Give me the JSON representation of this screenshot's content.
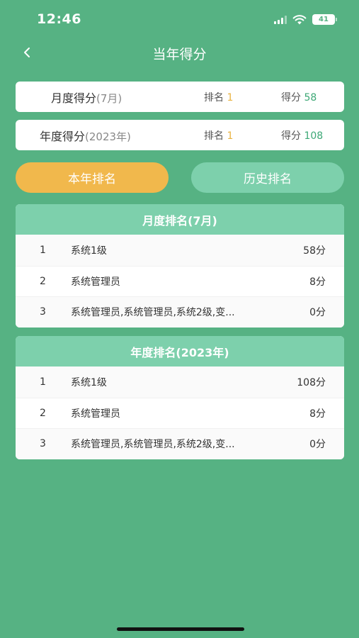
{
  "status": {
    "time": "12:46",
    "battery": "41"
  },
  "nav": {
    "title": "当年得分"
  },
  "score_cards": [
    {
      "label": "月度得分",
      "sub": "(7月)",
      "rank_label": "排名",
      "rank_value": "1",
      "score_label": "得分",
      "score_value": "58"
    },
    {
      "label": "年度得分",
      "sub": "(2023年)",
      "rank_label": "排名",
      "rank_value": "1",
      "score_label": "得分",
      "score_value": "108"
    }
  ],
  "tabs": {
    "current": "本年排名",
    "history": "历史排名"
  },
  "monthly": {
    "title": "月度排名(7月)",
    "rows": [
      {
        "rank": "1",
        "name": "系统1级",
        "points": "58分"
      },
      {
        "rank": "2",
        "name": "系统管理员",
        "points": "8分"
      },
      {
        "rank": "3",
        "name": "系统管理员,系统管理员,系统2级,变...",
        "points": "0分"
      }
    ]
  },
  "yearly": {
    "title": "年度排名(2023年)",
    "rows": [
      {
        "rank": "1",
        "name": "系统1级",
        "points": "108分"
      },
      {
        "rank": "2",
        "name": "系统管理员",
        "points": "8分"
      },
      {
        "rank": "3",
        "name": "系统管理员,系统管理员,系统2级,变...",
        "points": "0分"
      }
    ]
  },
  "colors": {
    "background": "#56b283",
    "accent": "#f1b84c",
    "header": "#7dd0ac",
    "rank_value": "#e9b341",
    "score_value": "#3da876"
  }
}
